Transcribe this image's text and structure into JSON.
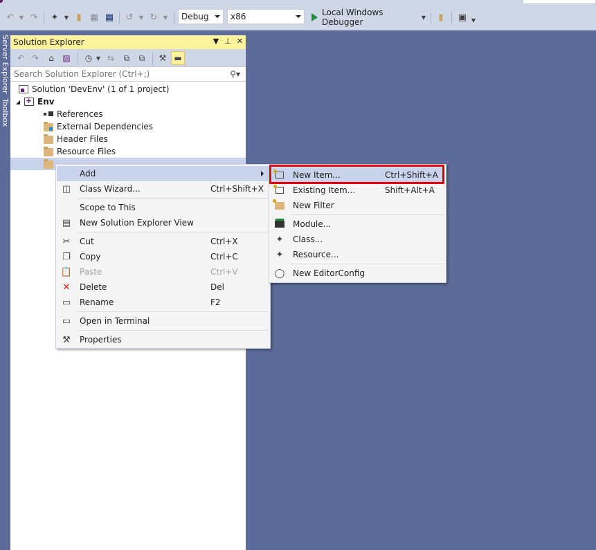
{
  "toolbar": {
    "configuration": "Debug",
    "platform": "x86",
    "debugger_label": "Local Windows Debugger",
    "icons": [
      "back-icon",
      "forward-icon",
      "new-item-icon",
      "open-icon",
      "save-icon",
      "save-all-icon",
      "undo-icon",
      "redo-icon",
      "start-debug-icon",
      "find-icon",
      "screenshot-icon"
    ]
  },
  "side_tabs": {
    "server_explorer": "Server Explorer",
    "toolbox": "Toolbox"
  },
  "solution_explorer": {
    "title": "Solution Explorer",
    "search_placeholder": "Search Solution Explorer (Ctrl+;)",
    "tree": {
      "solution": "Solution 'DevEnv' (1 of 1 project)",
      "project": "Env",
      "items": [
        "References",
        "External Dependencies",
        "Header Files",
        "Resource Files"
      ]
    }
  },
  "context_menu": {
    "items": [
      {
        "label": "Add",
        "shortcut": "",
        "icon": ""
      },
      {
        "label": "Class Wizard...",
        "shortcut": "Ctrl+Shift+X",
        "icon": "class-wizard-icon"
      },
      {
        "label": "Scope to This",
        "shortcut": "",
        "icon": ""
      },
      {
        "label": "New Solution Explorer View",
        "shortcut": "",
        "icon": "new-view-icon"
      },
      {
        "label": "Cut",
        "shortcut": "Ctrl+X",
        "icon": "scissors-icon"
      },
      {
        "label": "Copy",
        "shortcut": "Ctrl+C",
        "icon": "copy-icon"
      },
      {
        "label": "Paste",
        "shortcut": "Ctrl+V",
        "icon": "paste-icon"
      },
      {
        "label": "Delete",
        "shortcut": "Del",
        "icon": "delete-icon"
      },
      {
        "label": "Rename",
        "shortcut": "F2",
        "icon": "rename-icon"
      },
      {
        "label": "Open in Terminal",
        "shortcut": "",
        "icon": "terminal-icon"
      },
      {
        "label": "Properties",
        "shortcut": "",
        "icon": "wrench-icon"
      }
    ]
  },
  "add_submenu": {
    "items": [
      {
        "label": "New Item...",
        "shortcut": "Ctrl+Shift+A"
      },
      {
        "label": "Existing Item...",
        "shortcut": "Shift+Alt+A"
      },
      {
        "label": "New Filter",
        "shortcut": ""
      },
      {
        "label": "Module...",
        "shortcut": ""
      },
      {
        "label": "Class...",
        "shortcut": ""
      },
      {
        "label": "Resource...",
        "shortcut": ""
      },
      {
        "label": "New EditorConfig",
        "shortcut": ""
      }
    ]
  },
  "colors": {
    "background": "#5d6b99",
    "toolbar": "#cfd6e5",
    "panel_title_active": "#fff29d",
    "highlight": "#c9d3ec",
    "callout_red": "#e0000f"
  }
}
